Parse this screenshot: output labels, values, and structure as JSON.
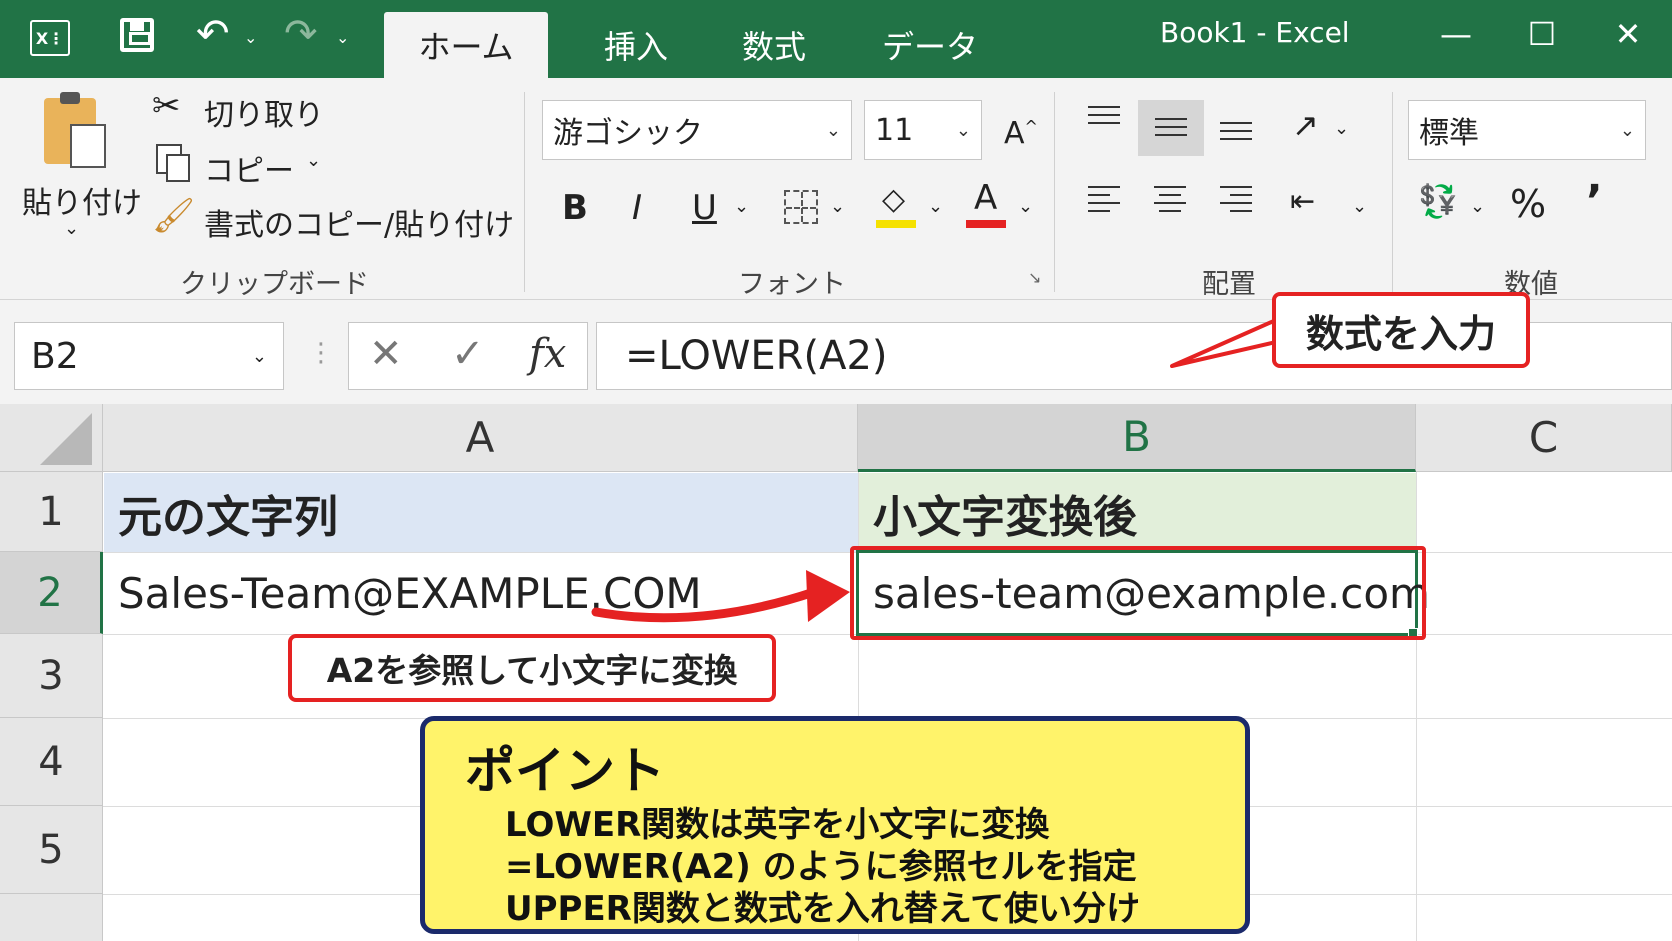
{
  "titlebar": {
    "app_icon": "X⋮",
    "title": "Book1  -  Excel",
    "tabs": [
      "ホーム",
      "挿入",
      "数式",
      "データ"
    ]
  },
  "ribbon": {
    "clipboard": {
      "paste": "貼り付け",
      "cut": "切り取り",
      "copy": "コピー",
      "format_painter": "書式のコピー/貼り付け",
      "label": "クリップボード"
    },
    "font": {
      "name": "游ゴシック",
      "size": "11",
      "bold": "B",
      "italic": "I",
      "underline": "U",
      "label": "フォント"
    },
    "alignment": {
      "label": "配置"
    },
    "number": {
      "format": "標準",
      "percent": "%",
      "comma": "’",
      "label": "数値"
    }
  },
  "formula_bar": {
    "name_box": "B2",
    "fx": "fx",
    "formula": "=LOWER(A2)"
  },
  "sheet": {
    "columns": [
      "A",
      "B",
      "C"
    ],
    "rows": [
      "1",
      "2",
      "3",
      "4",
      "5"
    ],
    "cells": {
      "A1": "元の文字列",
      "B1": "小文字変換後",
      "A2": "Sales-Team@EXAMPLE.COM",
      "B2": "sales-team@example.com"
    }
  },
  "callouts": {
    "formula_input": "数式を入力",
    "reference": "A2を参照して小文字に変換"
  },
  "point": {
    "title": "ポイント",
    "lines": [
      "LOWER関数は英字を小文字に変換",
      "=LOWER(A2) のように参照セルを指定",
      "UPPER関数と数式を入れ替えて使い分け"
    ]
  },
  "colors": {
    "excel_green": "#217346",
    "header_blue": "#dce6f4",
    "header_green": "#e2efda",
    "callout_red": "#e52222",
    "point_yellow": "#fff36a",
    "point_border": "#1b2a6b"
  }
}
